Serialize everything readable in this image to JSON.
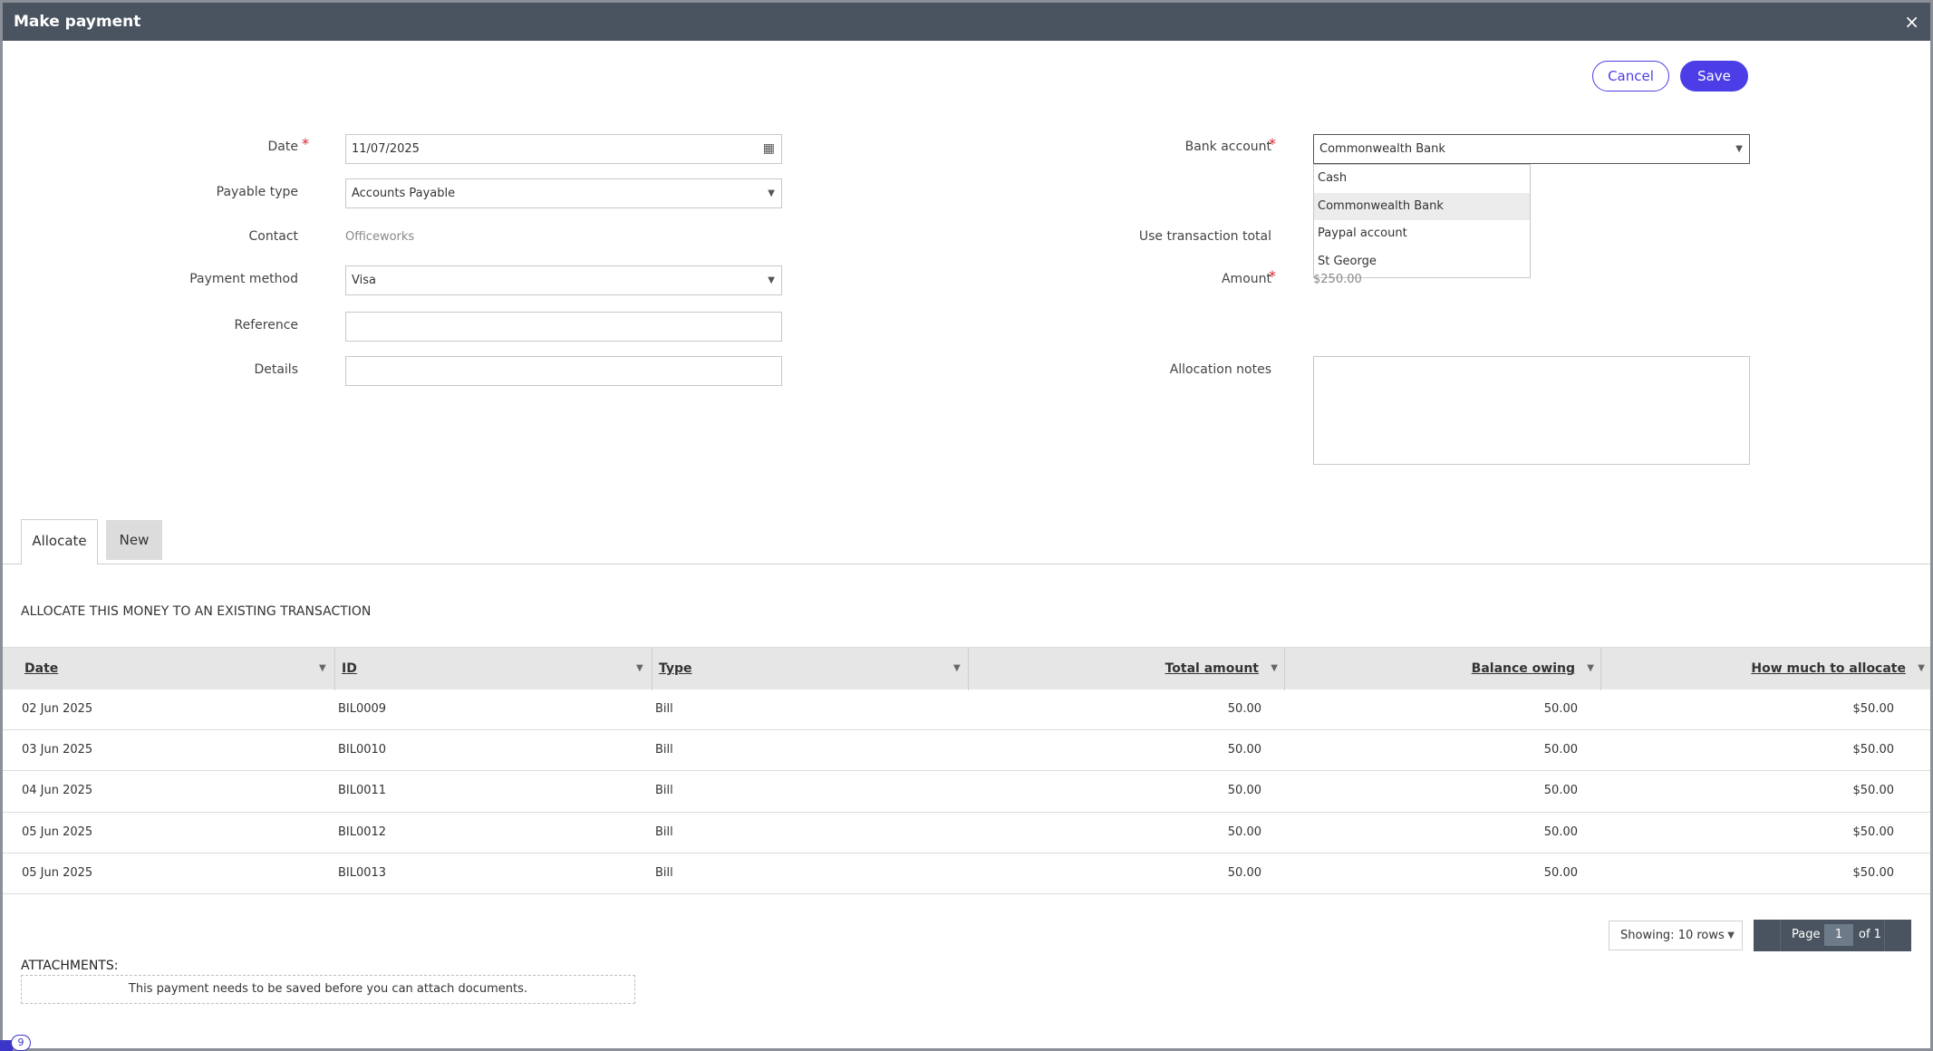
{
  "dialog": {
    "title": "Make payment",
    "close_label": "×"
  },
  "toolbar": {
    "cancel_label": "Cancel",
    "save_label": "Save"
  },
  "form": {
    "date": {
      "label": "Date",
      "value": "11/07/2025"
    },
    "payable_type": {
      "label": "Payable type",
      "value": "Accounts Payable"
    },
    "contact": {
      "label": "Contact",
      "value": "Officeworks"
    },
    "payment_method": {
      "label": "Payment method",
      "value": "Visa"
    },
    "reference": {
      "label": "Reference",
      "value": ""
    },
    "details": {
      "label": "Details",
      "value": ""
    },
    "bank_account": {
      "label": "Bank account",
      "value": "Commonwealth Bank",
      "options": [
        "Cash",
        "Commonwealth Bank",
        "Paypal account",
        "St George"
      ],
      "highlighted": "Commonwealth Bank"
    },
    "use_transaction_total": {
      "label": "Use transaction total"
    },
    "amount": {
      "label": "Amount",
      "value": "$250.00"
    },
    "allocation_notes": {
      "label": "Allocation notes",
      "value": ""
    }
  },
  "tabs": [
    {
      "label": "Allocate",
      "active": true
    },
    {
      "label": "New",
      "active": false
    }
  ],
  "allocate": {
    "heading": "ALLOCATE THIS MONEY TO AN EXISTING TRANSACTION",
    "columns": [
      "Date",
      "ID",
      "Type",
      "Total amount",
      "Balance owing",
      "How much to allocate"
    ],
    "rows": [
      [
        "02 Jun 2025",
        "BIL0009",
        "Bill",
        "50.00",
        "50.00",
        "$50.00"
      ],
      [
        "03 Jun 2025",
        "BIL0010",
        "Bill",
        "50.00",
        "50.00",
        "$50.00"
      ],
      [
        "04 Jun 2025",
        "BIL0011",
        "Bill",
        "50.00",
        "50.00",
        "$50.00"
      ],
      [
        "05 Jun 2025",
        "BIL0012",
        "Bill",
        "50.00",
        "50.00",
        "$50.00"
      ],
      [
        "05 Jun 2025",
        "BIL0013",
        "Bill",
        "50.00",
        "50.00",
        "$50.00"
      ]
    ],
    "rows_selector": "Showing: 10 rows",
    "pager": {
      "page_label": "Page",
      "current": "1",
      "of_label": "of 1"
    }
  },
  "attachments": {
    "label": "ATTACHMENTS:",
    "message": "This payment needs to be saved before you can attach documents."
  },
  "badge": {
    "count": "9"
  },
  "colors": {
    "accent": "#4b3ee6",
    "titlebar": "#4a5460",
    "required": "#d9262c"
  }
}
